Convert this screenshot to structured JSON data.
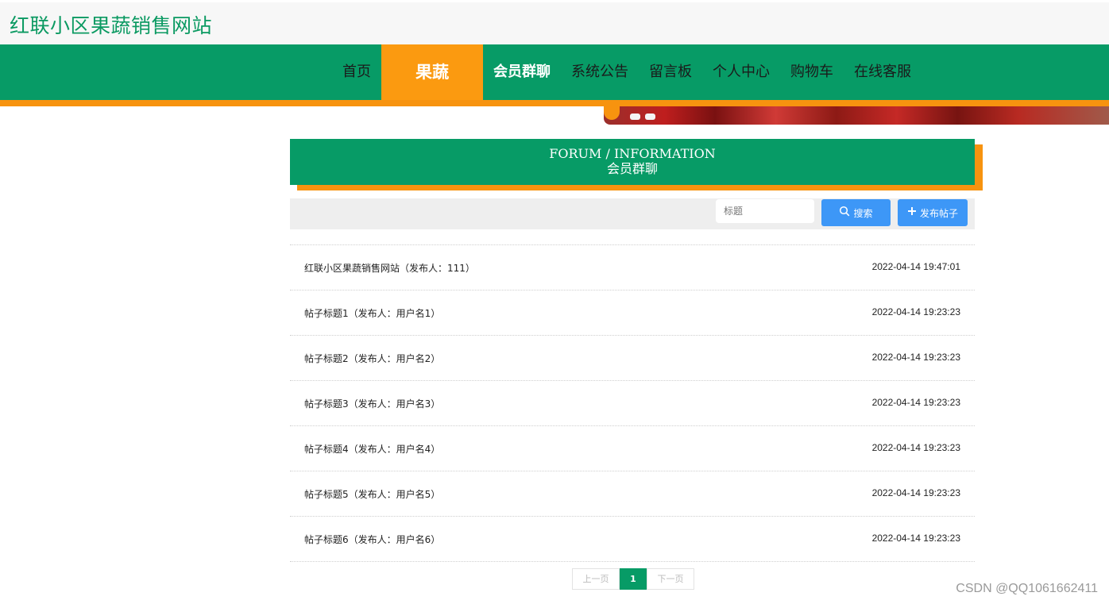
{
  "site": {
    "title": "红联小区果蔬销售网站"
  },
  "nav": {
    "items": [
      {
        "label": "首页"
      },
      {
        "label": "果蔬"
      },
      {
        "label": "会员群聊"
      },
      {
        "label": "系统公告"
      },
      {
        "label": "留言板"
      },
      {
        "label": "个人中心"
      },
      {
        "label": "购物车"
      },
      {
        "label": "在线客服"
      }
    ],
    "active": "果蔬"
  },
  "forum": {
    "heading_en": "FORUM / INFORMATION",
    "heading_cn": "会员群聊"
  },
  "search": {
    "placeholder": "标题",
    "search_label": "搜索",
    "post_label": "发布帖子"
  },
  "posts": [
    {
      "title": "红联小区果蔬销售网站（发布人：111）",
      "time": "2022-04-14 19:47:01"
    },
    {
      "title": "帖子标题1（发布人：用户名1）",
      "time": "2022-04-14 19:23:23"
    },
    {
      "title": "帖子标题2（发布人：用户名2）",
      "time": "2022-04-14 19:23:23"
    },
    {
      "title": "帖子标题3（发布人：用户名3）",
      "time": "2022-04-14 19:23:23"
    },
    {
      "title": "帖子标题4（发布人：用户名4）",
      "time": "2022-04-14 19:23:23"
    },
    {
      "title": "帖子标题5（发布人：用户名5）",
      "time": "2022-04-14 19:23:23"
    },
    {
      "title": "帖子标题6（发布人：用户名6）",
      "time": "2022-04-14 19:23:23"
    }
  ],
  "pagination": {
    "prev": "上一页",
    "current": "1",
    "next": "下一页"
  },
  "watermark": "CSDN @QQ1061662411",
  "colors": {
    "primary": "#079b66",
    "accent": "#f7930f",
    "button": "#3d97f7"
  }
}
